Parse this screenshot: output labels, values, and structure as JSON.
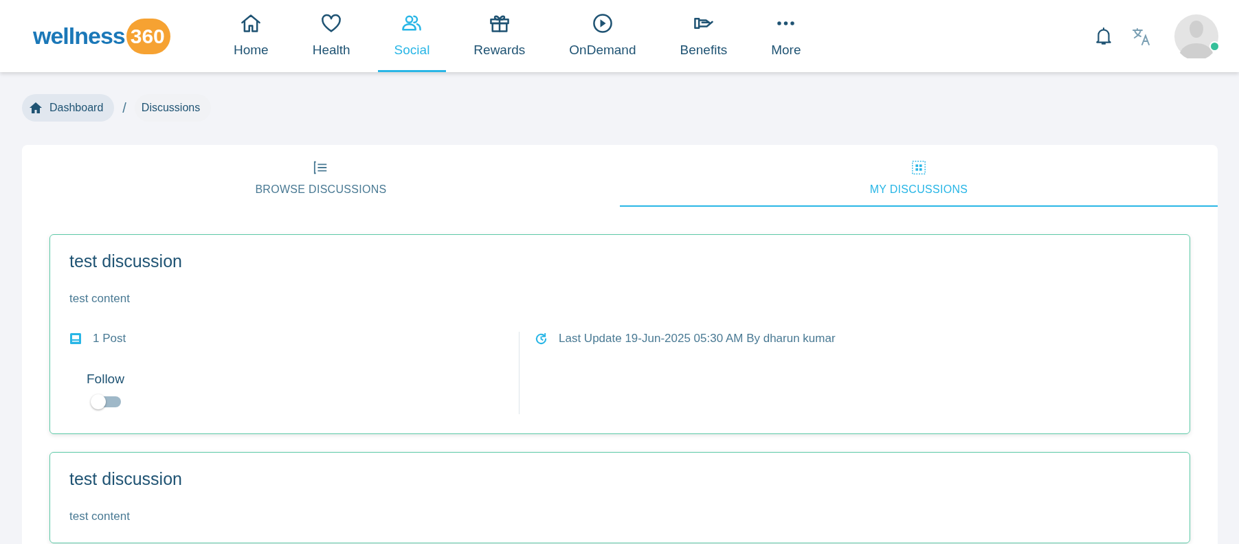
{
  "logo": {
    "text": "wellness",
    "badge": "360"
  },
  "nav": [
    {
      "label": "Home",
      "selected": false
    },
    {
      "label": "Health",
      "selected": false
    },
    {
      "label": "Social",
      "selected": true
    },
    {
      "label": "Rewards",
      "selected": false
    },
    {
      "label": "OnDemand",
      "selected": false
    },
    {
      "label": "Benefits",
      "selected": false
    },
    {
      "label": "More",
      "selected": false
    }
  ],
  "user": {
    "online": true
  },
  "breadcrumb": [
    {
      "label": "Dashboard",
      "kind": "home"
    },
    {
      "label": "/",
      "kind": "separator"
    },
    {
      "label": "Discussions",
      "kind": "current"
    }
  ],
  "tabs": [
    {
      "label": "BROWSE DISCUSSIONS",
      "selected": false
    },
    {
      "label": "MY DISCUSSIONS",
      "selected": true
    }
  ],
  "discussions": [
    {
      "title": "test discussion",
      "content": "test content",
      "posts": "1 Post",
      "last_update": "Last Update 19-Jun-2025 05:30 AM By dharun kumar",
      "follow": {
        "label": "Follow",
        "on": false
      }
    },
    {
      "title": "test discussion",
      "content": "test content"
    }
  ]
}
